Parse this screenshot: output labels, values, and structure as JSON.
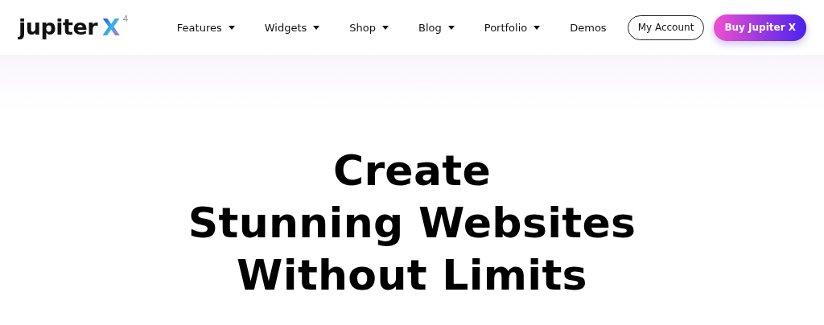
{
  "logo": {
    "word": "jupiter",
    "mark": "X",
    "version": "4"
  },
  "nav": [
    {
      "label": "Features",
      "dropdown": true
    },
    {
      "label": "Widgets",
      "dropdown": true
    },
    {
      "label": "Shop",
      "dropdown": true
    },
    {
      "label": "Blog",
      "dropdown": true
    },
    {
      "label": "Portfolio",
      "dropdown": true
    },
    {
      "label": "Demos",
      "dropdown": false
    }
  ],
  "buttons": [
    {
      "label": "My Account",
      "kind": "outline"
    },
    {
      "label": "Buy Jupiter X",
      "kind": "gradient"
    }
  ],
  "hero": {
    "lines": [
      "Create",
      "Stunning Websites",
      "Without Limits"
    ]
  }
}
